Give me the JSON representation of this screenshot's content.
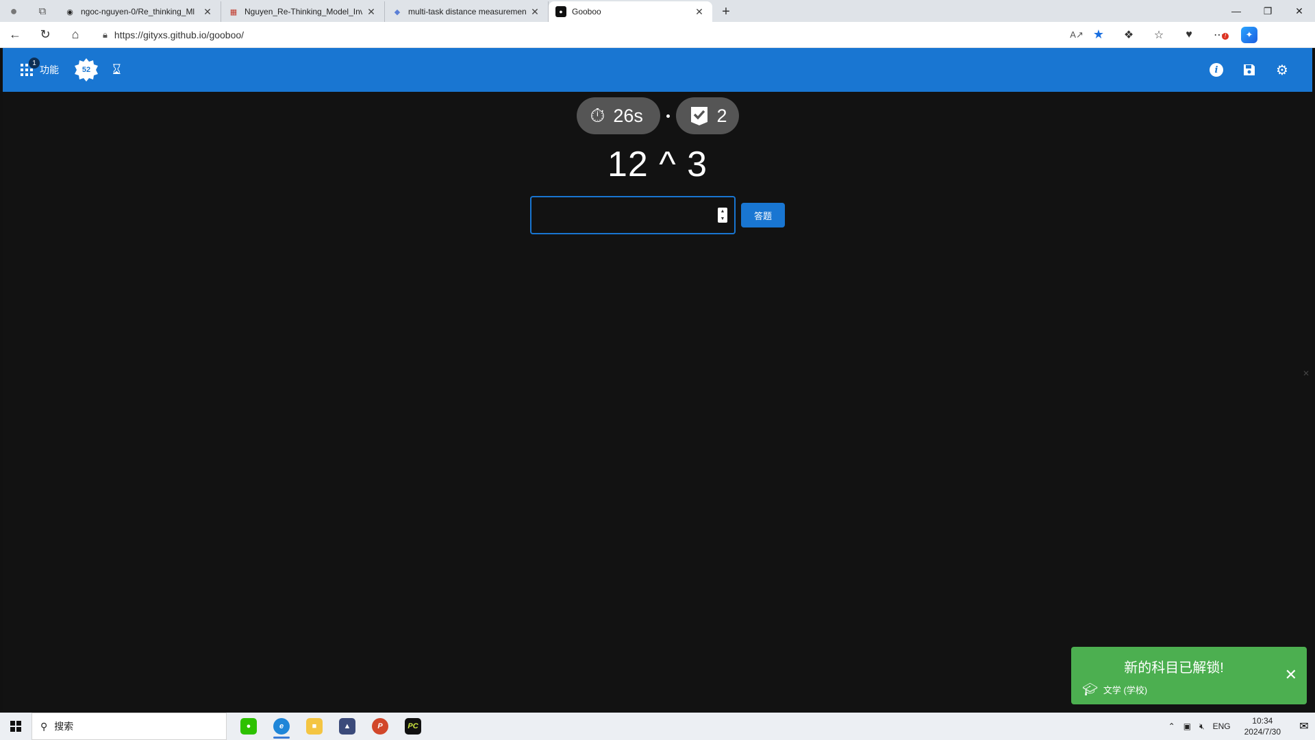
{
  "browser": {
    "tabs": [
      {
        "title": "ngoc-nguyen-0/Re_thinking_Ml",
        "favicon": "github-icon",
        "active": false
      },
      {
        "title": "Nguyen_Re-Thinking_Model_Inve",
        "favicon": "pdf-icon",
        "active": false
      },
      {
        "title": "multi-task distance measuremen",
        "favicon": "site-icon",
        "active": false
      },
      {
        "title": "Gooboo",
        "favicon": "gooboo-icon",
        "active": true
      }
    ],
    "url": "https://gityxs.github.io/gooboo/"
  },
  "app": {
    "menu_label": "功能",
    "menu_badge": "1",
    "level": "52",
    "timer": "26s",
    "correct_count": "2",
    "question": "12 ^ 3",
    "answer_value": "",
    "answer_placeholder": "",
    "submit_label": "答题",
    "accent": "#1976d2",
    "background": "#121212"
  },
  "toast": {
    "title": "新的科目已解锁!",
    "subtitle": "文学 (学校)",
    "color": "#4caf50"
  },
  "taskbar": {
    "search_placeholder": "搜索",
    "language": "ENG",
    "time": "10:34",
    "date": "2024/7/30",
    "notification_count": "1"
  }
}
